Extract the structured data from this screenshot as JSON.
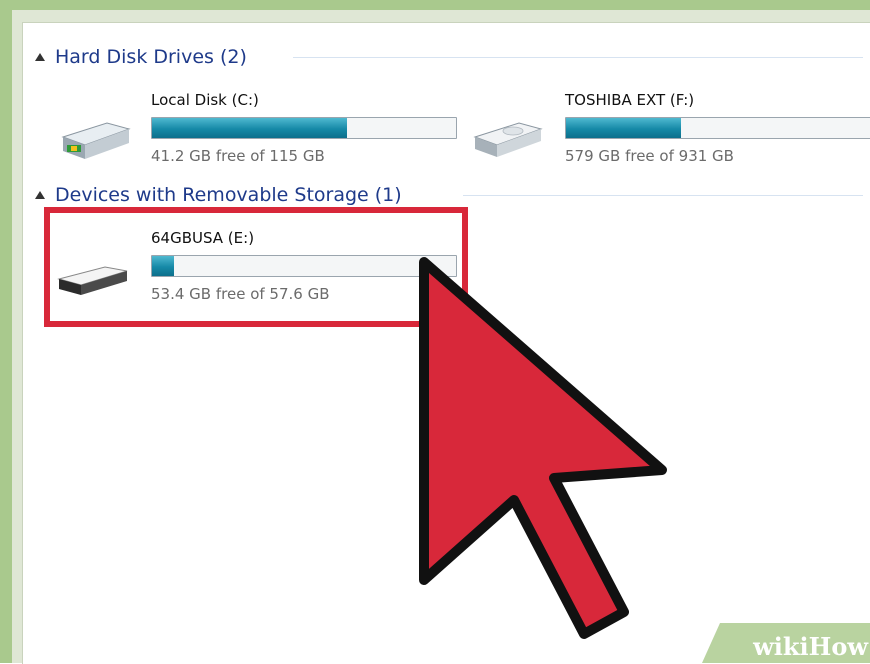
{
  "groups": [
    {
      "title": "Hard Disk Drives (2)",
      "drives": [
        {
          "name": "Local Disk (C:)",
          "free_text": "41.2 GB free of 115 GB",
          "used_fraction": 0.642,
          "icon": "system-drive-icon"
        },
        {
          "name": "TOSHIBA EXT (F:)",
          "free_text": "579 GB free of 931 GB",
          "used_fraction": 0.378,
          "icon": "hard-drive-icon"
        }
      ]
    },
    {
      "title": "Devices with Removable Storage (1)",
      "drives": [
        {
          "name": "64GBUSA (E:)",
          "free_text": "53.4 GB free of 57.6 GB",
          "used_fraction": 0.073,
          "icon": "usb-drive-icon"
        }
      ]
    }
  ],
  "colors": {
    "group_title": "#1e3a8a",
    "bar_fill": "#1689a7",
    "highlight": "#d8283a",
    "cursor_fill": "#d8283a",
    "frame_green": "#a9c98d"
  },
  "watermark": {
    "text": "wikiHow"
  }
}
